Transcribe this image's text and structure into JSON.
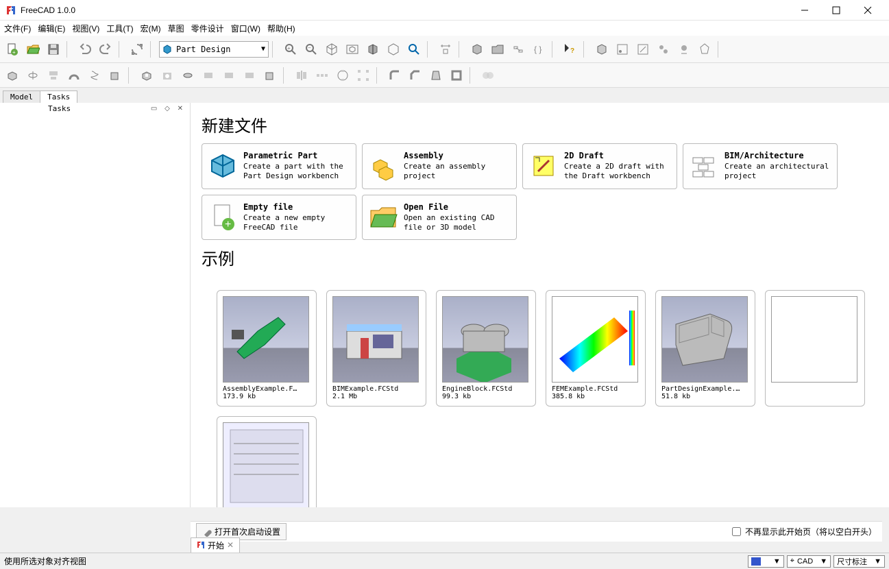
{
  "titlebar": {
    "title": "FreeCAD 1.0.0"
  },
  "menubar": [
    "文件(F)",
    "编辑(E)",
    "视图(V)",
    "工具(T)",
    "宏(M)",
    "草图",
    "零件设计",
    "窗口(W)",
    "帮助(H)"
  ],
  "workbench": {
    "label": "Part Design"
  },
  "side_tabs": {
    "model": "Model",
    "tasks": "Tasks",
    "panel_title": "Tasks"
  },
  "sections": {
    "new_file": "新建文件",
    "examples": "示例"
  },
  "cards": [
    {
      "title": "Parametric Part",
      "desc": "Create a part with the Part Design workbench",
      "icon": "part"
    },
    {
      "title": "Assembly",
      "desc": "Create an assembly project",
      "icon": "assembly"
    },
    {
      "title": "2D Draft",
      "desc": "Create a 2D draft with the Draft workbench",
      "icon": "draft"
    },
    {
      "title": "BIM/Architecture",
      "desc": "Create an architectural project",
      "icon": "bim"
    },
    {
      "title": "Empty file",
      "desc": "Create a new empty FreeCAD file",
      "icon": "empty"
    },
    {
      "title": "Open File",
      "desc": "Open an existing CAD file or 3D model",
      "icon": "open"
    }
  ],
  "examples": [
    {
      "name": "AssemblyExample.F…",
      "size": "173.9 kb"
    },
    {
      "name": "BIMExample.FCStd",
      "size": "2.1 Mb"
    },
    {
      "name": "EngineBlock.FCStd",
      "size": "99.3 kb"
    },
    {
      "name": "FEMExample.FCStd",
      "size": "385.8 kb"
    },
    {
      "name": "PartDesignExample.…",
      "size": "51.8 kb"
    },
    {
      "name": "",
      "size": ""
    },
    {
      "name": "",
      "size": ""
    }
  ],
  "bottom": {
    "first_run": "打开首次启动设置",
    "dont_show": "不再显示此开始页（将以空白开头）"
  },
  "doc_tab": "开始",
  "statusbar": {
    "text": "使用所选对象对齐视图",
    "cad": "CAD",
    "dim": "尺寸标注"
  }
}
